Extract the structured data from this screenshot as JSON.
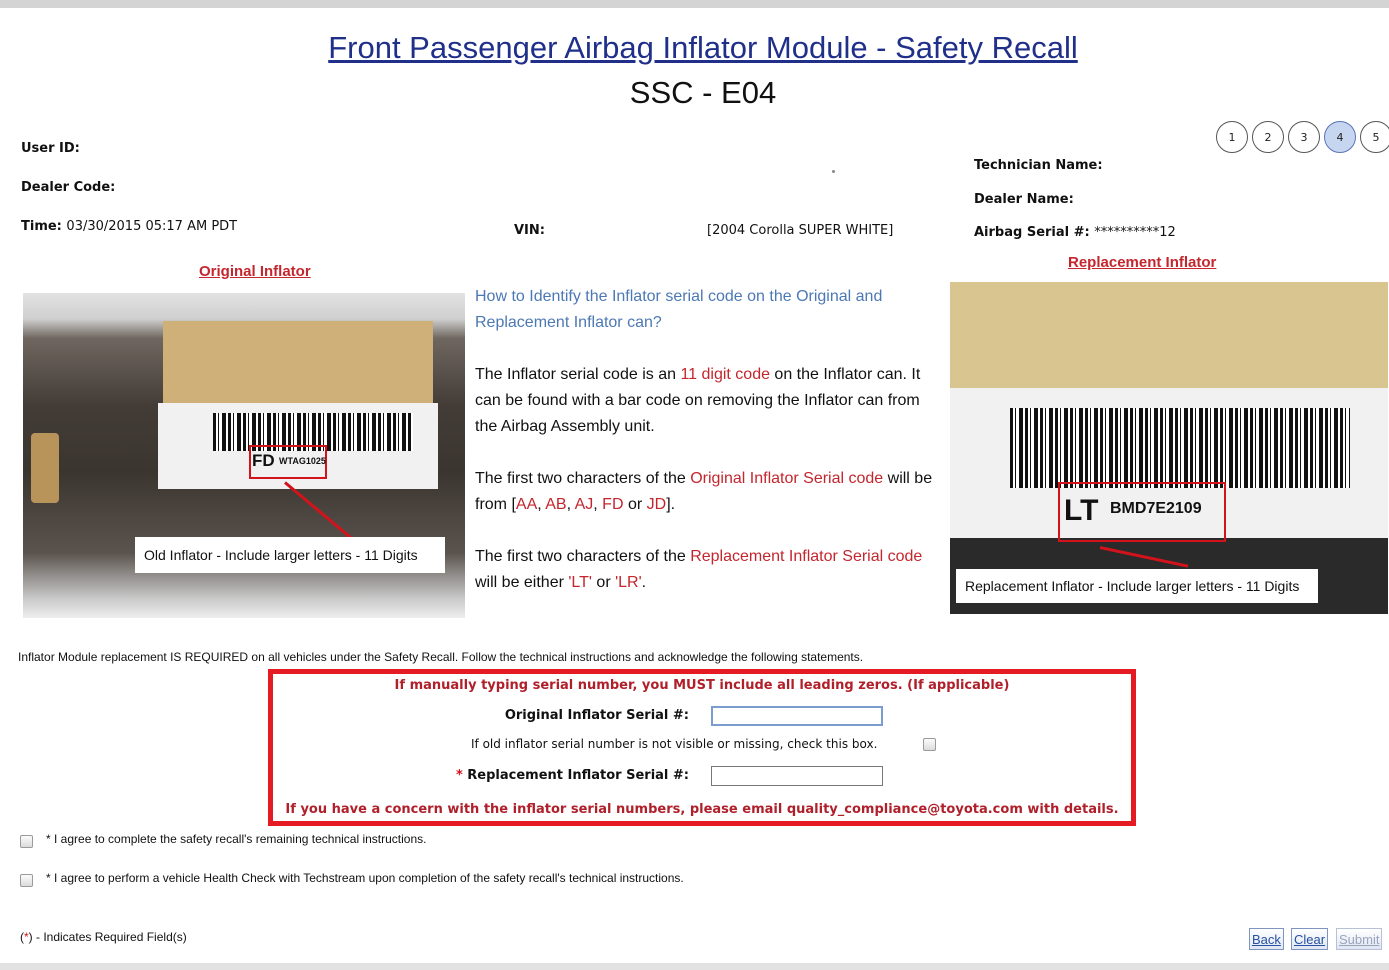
{
  "header": {
    "title": "Front Passenger Airbag Inflator Module - Safety Recall",
    "subtitle": "SSC - E04"
  },
  "steps": [
    "1",
    "2",
    "3",
    "4",
    "5"
  ],
  "active_step": "4",
  "left_info": {
    "user_id_label": "User ID:",
    "dealer_code_label": "Dealer Code:",
    "time_label": "Time:",
    "time_value": "03/30/2015 05:17 AM PDT"
  },
  "vin": {
    "label": "VIN:",
    "vehicle": "[2004 Corolla SUPER WHITE]"
  },
  "right_info": {
    "technician_label": "Technician Name:",
    "dealer_name_label": "Dealer Name:",
    "airbag_serial_label": "Airbag Serial #:",
    "airbag_serial_value": "**********12"
  },
  "original": {
    "section_title": "Original Inflator",
    "serial_prefix": "FD",
    "serial_rest": "WTAG1025",
    "caption": "Old Inflator - Include larger letters - 11 Digits"
  },
  "replacement": {
    "section_title": "Replacement Inflator",
    "serial_prefix": "LT",
    "serial_rest": "BMD7E2109",
    "caption": "Replacement Inflator - Include larger letters - 11 Digits"
  },
  "info": {
    "question": "How to Identify the Inflator serial code on the Original and Replacement Inflator can?",
    "p1_a": "The Inflator serial code is an ",
    "p1_hl": "11 digit code",
    "p1_b": " on the Inflator can. It can be found with a bar code on removing the Inflator can from the Airbag Assembly unit.",
    "p2_a": "The first two characters of the ",
    "p2_hl": "Original Inflator Serial code",
    "p2_b": " will be from [",
    "p2_codes": [
      "AA",
      "AB",
      "AJ",
      "FD",
      "JD"
    ],
    "p2_sep": ", ",
    "p2_or": " or ",
    "p2_end": "].",
    "p3_a": "The first two characters of the ",
    "p3_hl": "Replacement Inflator Serial code",
    "p3_b": " will be either ",
    "p3_c1": "'LT'",
    "p3_or": " or ",
    "p3_c2": "'LR'",
    "p3_end": "."
  },
  "notice": "Inflator Module replacement IS REQUIRED on all vehicles under the Safety Recall. Follow the technical instructions and acknowledge the following statements.",
  "form": {
    "warning": "If manually typing serial number, you MUST include all leading zeros. (If applicable)",
    "original_label": "Original Inflator Serial #:",
    "original_value": "",
    "missing_text": "If old inflator serial number is not visible or missing, check this box.",
    "replacement_req": "*",
    "replacement_label": " Replacement Inflator Serial #:",
    "replacement_value": "",
    "concern": "If you have a concern with the inflator serial numbers, please email quality_compliance@toyota.com with details."
  },
  "agreements": [
    "* I agree to complete the safety recall's remaining technical instructions.",
    "* I agree to perform a vehicle Health Check with Techstream upon completion of the safety recall's technical instructions."
  ],
  "legend": {
    "open": "(",
    "star": "*",
    "close": ") - Indicates Required Field(s)"
  },
  "buttons": {
    "back": "Back",
    "clear": "Clear",
    "submit": "Submit"
  },
  "colors": {
    "title_blue": "#1f2f8a",
    "accent_red": "#c4262e",
    "frame_red": "#e41b23",
    "question_blue": "#4c78b4"
  }
}
